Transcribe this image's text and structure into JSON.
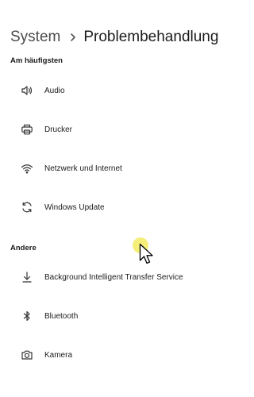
{
  "breadcrumb": {
    "parent": "System",
    "current": "Problembehandlung"
  },
  "sections": {
    "frequent": {
      "heading": "Am häufigsten",
      "items": [
        {
          "label": "Audio",
          "icon": "speaker-icon"
        },
        {
          "label": "Drucker",
          "icon": "printer-icon"
        },
        {
          "label": "Netzwerk und Internet",
          "icon": "wifi-icon"
        },
        {
          "label": "Windows Update",
          "icon": "sync-icon"
        }
      ]
    },
    "other": {
      "heading": "Andere",
      "items": [
        {
          "label": "Background Intelligent Transfer Service",
          "icon": "download-icon"
        },
        {
          "label": "Bluetooth",
          "icon": "bluetooth-icon"
        },
        {
          "label": "Kamera",
          "icon": "camera-icon"
        }
      ]
    }
  },
  "colors": {
    "cursor_highlight": "#f4ed6a",
    "text": "#1b1b1b",
    "background": "#ffffff"
  }
}
